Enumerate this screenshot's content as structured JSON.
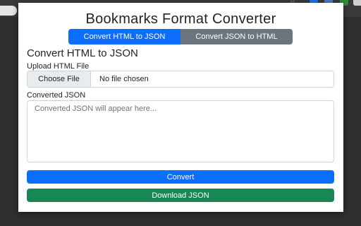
{
  "popup": {
    "title": "Bookmarks Format Converter",
    "tabs": [
      {
        "label": "Convert HTML to JSON",
        "active": true
      },
      {
        "label": "Convert JSON to HTML",
        "active": false
      }
    ],
    "section_heading": "Convert HTML to JSON",
    "upload": {
      "label": "Upload HTML File",
      "button_label": "Choose File",
      "status": "No file chosen"
    },
    "output": {
      "label": "Converted JSON",
      "placeholder": "Converted JSON will appear here..."
    },
    "convert_button": "Convert",
    "download_button": "Download JSON"
  },
  "colors": {
    "primary": "#0d6efd",
    "secondary": "#6c757d",
    "success": "#198754"
  },
  "browser_toolbar": {
    "icons": [
      "bookmark-star-icon",
      "extension-icon-1",
      "extension-icon-2",
      "extension-icon-3",
      "extension-icon-active"
    ]
  }
}
